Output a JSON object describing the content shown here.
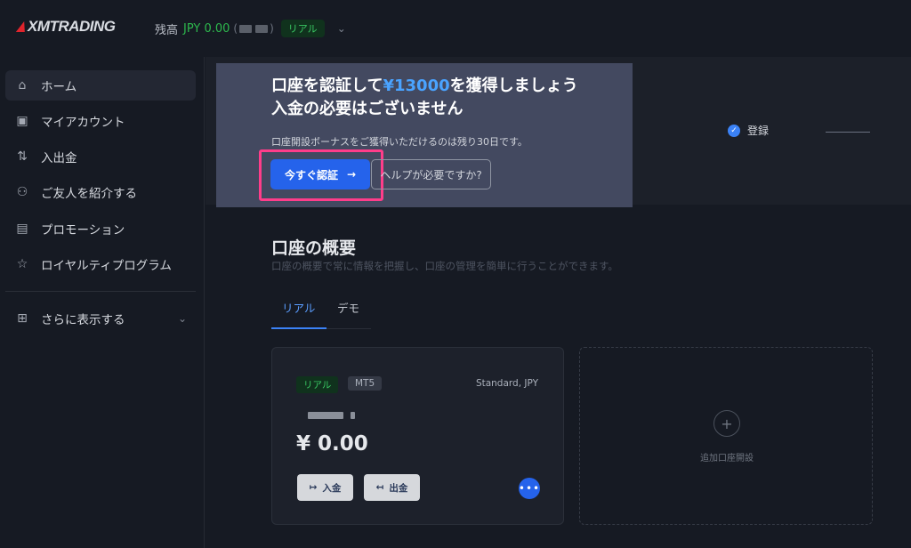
{
  "header": {
    "logo_text": "XMTRADING",
    "balance_label": "残高",
    "balance_value": "JPY 0.00",
    "paren_open": "(",
    "paren_close": ")",
    "account_badge": "リアル"
  },
  "sidebar": {
    "items": [
      {
        "label": "ホーム",
        "icon": "home-icon",
        "active": true
      },
      {
        "label": "マイアカウント",
        "icon": "card-icon"
      },
      {
        "label": "入出金",
        "icon": "arrows-updown-icon"
      },
      {
        "label": "ご友人を紹介する",
        "icon": "users-icon"
      },
      {
        "label": "プロモーション",
        "icon": "gift-icon"
      },
      {
        "label": "ロイヤルティプログラム",
        "icon": "star-icon"
      }
    ],
    "more_label": "さらに表示する"
  },
  "promo": {
    "title_prefix": "口座を認証して",
    "title_amount": "¥13000",
    "title_suffix": "を獲得しましょう",
    "title_line2": "入金の必要はございません",
    "subtitle": "口座開設ボーナスをご獲得いただけるのは残り30日です。",
    "verify_button": "今すぐ認証",
    "help_button": "ヘルプが必要ですか?"
  },
  "steps": {
    "registered_label": "登録"
  },
  "overview": {
    "title": "口座の概要",
    "description": "口座の概要で常に情報を把握し、口座の管理を簡単に行うことができます。",
    "tabs": [
      "リアル",
      "デモ"
    ]
  },
  "account_card": {
    "tag_real": "リアル",
    "tag_platform": "MT5",
    "account_type": "Standard, JPY",
    "balance": "¥ 0.00",
    "deposit_label": "入金",
    "withdraw_label": "出金"
  },
  "add_account": {
    "label": "追加口座開設"
  },
  "colors": {
    "accent": "#2563eb",
    "positive": "#2db84d",
    "highlight": "#ff3d8a"
  }
}
